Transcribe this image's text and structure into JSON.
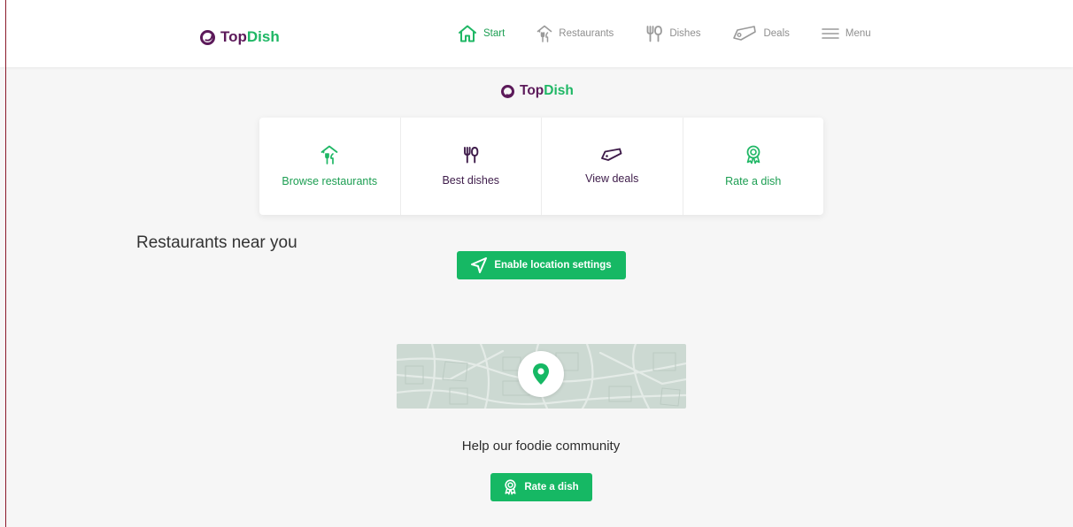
{
  "brand": {
    "part1": "Top",
    "part2": "Dish"
  },
  "nav": [
    {
      "label": "Start",
      "icon": "home-icon",
      "active": true
    },
    {
      "label": "Restaurants",
      "icon": "restaurant-icon",
      "active": false
    },
    {
      "label": "Dishes",
      "icon": "cutlery-icon",
      "active": false
    },
    {
      "label": "Deals",
      "icon": "tag-icon",
      "active": false
    },
    {
      "label": "Menu",
      "icon": "hamburger-icon",
      "active": false
    }
  ],
  "actions": [
    {
      "label": "Browse restaurants",
      "icon": "restaurant-icon"
    },
    {
      "label": "Best dishes",
      "icon": "cutlery-icon"
    },
    {
      "label": "View deals",
      "icon": "tag-icon"
    },
    {
      "label": "Rate a dish",
      "icon": "award-icon"
    }
  ],
  "near": {
    "title": "Restaurants near you",
    "location_button": "Enable location settings"
  },
  "community": {
    "text": "Help our foodie community",
    "rate_button": "Rate a dish"
  },
  "colors": {
    "brand_purple": "#5c1a5a",
    "brand_green": "#1fb765",
    "button_green": "#16b864",
    "map_bg": "#ccd9d2"
  }
}
